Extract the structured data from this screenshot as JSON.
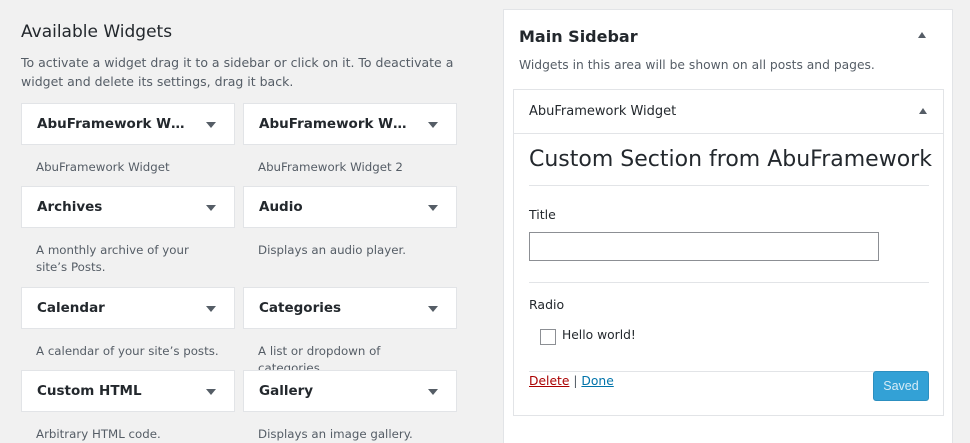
{
  "available": {
    "heading": "Available Widgets",
    "description": "To activate a widget drag it to a sidebar or click on it. To deactivate a widget and delete its settings, drag it back."
  },
  "widgets": [
    {
      "title": "AbuFramework Widget",
      "description": "AbuFramework Widget"
    },
    {
      "title": "AbuFramework Widg...",
      "description": "AbuFramework Widget 2"
    },
    {
      "title": "Archives",
      "description": "A monthly archive of your site’s Posts."
    },
    {
      "title": "Audio",
      "description": "Displays an audio player."
    },
    {
      "title": "Calendar",
      "description": "A calendar of your site’s posts."
    },
    {
      "title": "Categories",
      "description": "A list or dropdown of categories."
    },
    {
      "title": "Custom HTML",
      "description": "Arbitrary HTML code."
    },
    {
      "title": "Gallery",
      "description": "Displays an image gallery."
    }
  ],
  "sidebar": {
    "title": "Main Sidebar",
    "description": "Widgets in this area will be shown on all posts and pages.",
    "widget": {
      "title": "AbuFramework Widget",
      "section_heading": "Custom Section from AbuFramework",
      "title_label": "Title",
      "title_value": "",
      "radio_label": "Radio",
      "checkbox_label": "Hello world!",
      "checkbox_checked": false,
      "delete_label": "Delete",
      "separator": "|",
      "done_label": "Done",
      "saved_label": "Saved"
    }
  }
}
